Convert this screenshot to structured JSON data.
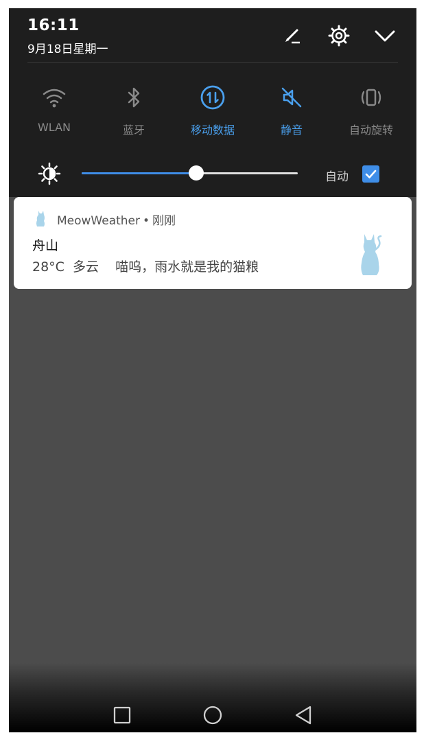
{
  "status": {
    "time": "16:11",
    "date": "9月18日星期一"
  },
  "header_icons": [
    "edit-icon",
    "settings-gear-icon",
    "chevron-down-icon"
  ],
  "quick_tiles": [
    {
      "label": "WLAN",
      "icon": "wifi-icon",
      "active": false
    },
    {
      "label": "蓝牙",
      "icon": "bluetooth-icon",
      "active": false
    },
    {
      "label": "移动数据",
      "icon": "mobile-data-icon",
      "active": true
    },
    {
      "label": "静音",
      "icon": "mute-icon",
      "active": true
    },
    {
      "label": "自动旋转",
      "icon": "auto-rotate-icon",
      "active": false
    }
  ],
  "brightness": {
    "icon": "brightness-icon",
    "level": 0.53,
    "auto_label": "自动",
    "auto_checked": true
  },
  "notification": {
    "app_name": "MeowWeather",
    "separator": "•",
    "time": "刚刚",
    "title": "舟山",
    "body": "28°C  多云    喵呜，雨水就是我的猫粮",
    "app_icon": "cat-icon"
  },
  "nav": [
    "recents-square-icon",
    "home-circle-icon",
    "back-triangle-icon"
  ],
  "colors": {
    "accent": "#3f8ee8",
    "active_label": "#4aa0ee",
    "panel_bg": "#1e1e1e",
    "screen_bg": "#4c4c4c",
    "cat_blue": "#a9d4ea"
  }
}
